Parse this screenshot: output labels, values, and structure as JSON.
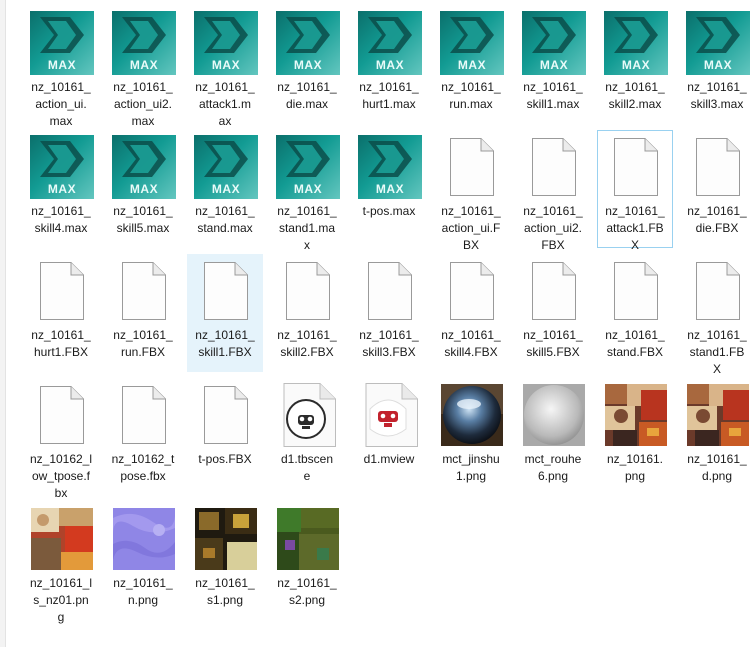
{
  "icon_text": "MAX",
  "files": [
    {
      "name": "nz_10161_action_ui.max",
      "type": "max",
      "label": "nz_10161_\naction_ui.\nmax"
    },
    {
      "name": "nz_10161_action_ui2.max",
      "type": "max",
      "label": "nz_10161_\naction_ui2.\nmax"
    },
    {
      "name": "nz_10161_attack1.max",
      "type": "max",
      "label": "nz_10161_\nattack1.m\nax"
    },
    {
      "name": "nz_10161_die.max",
      "type": "max",
      "label": "nz_10161_\ndie.max"
    },
    {
      "name": "nz_10161_hurt1.max",
      "type": "max",
      "label": "nz_10161_\nhurt1.max"
    },
    {
      "name": "nz_10161_run.max",
      "type": "max",
      "label": "nz_10161_\nrun.max"
    },
    {
      "name": "nz_10161_skill1.max",
      "type": "max",
      "label": "nz_10161_\nskill1.max"
    },
    {
      "name": "nz_10161_skill2.max",
      "type": "max",
      "label": "nz_10161_\nskill2.max"
    },
    {
      "name": "nz_10161_skill3.max",
      "type": "max",
      "label": "nz_10161_\nskill3.max"
    },
    {
      "name": "nz_10161_skill4.max",
      "type": "max",
      "label": "nz_10161_\nskill4.max"
    },
    {
      "name": "nz_10161_skill5.max",
      "type": "max",
      "label": "nz_10161_\nskill5.max"
    },
    {
      "name": "nz_10161_stand.max",
      "type": "max",
      "label": "nz_10161_\nstand.max"
    },
    {
      "name": "nz_10161_stand1.max",
      "type": "max",
      "label": "nz_10161_\nstand1.ma\nx"
    },
    {
      "name": "t-pos.max",
      "type": "max",
      "label": "t-pos.max"
    },
    {
      "name": "nz_10161_action_ui.FBX",
      "type": "doc",
      "label": "nz_10161_\naction_ui.F\nBX"
    },
    {
      "name": "nz_10161_action_ui2.FBX",
      "type": "doc",
      "label": "nz_10161_\naction_ui2.\nFBX"
    },
    {
      "name": "nz_10161_attack1.FBX",
      "type": "doc",
      "label": "nz_10161_\nattack1.FB\nX",
      "state": "focused"
    },
    {
      "name": "nz_10161_die.FBX",
      "type": "doc",
      "label": "nz_10161_\ndie.FBX"
    },
    {
      "name": "nz_10161_hurt1.FBX",
      "type": "doc",
      "label": "nz_10161_\nhurt1.FBX"
    },
    {
      "name": "nz_10161_run.FBX",
      "type": "doc",
      "label": "nz_10161_\nrun.FBX"
    },
    {
      "name": "nz_10161_skill1.FBX",
      "type": "doc",
      "label": "nz_10161_\nskill1.FBX",
      "state": "selected"
    },
    {
      "name": "nz_10161_skill2.FBX",
      "type": "doc",
      "label": "nz_10161_\nskill2.FBX"
    },
    {
      "name": "nz_10161_skill3.FBX",
      "type": "doc",
      "label": "nz_10161_\nskill3.FBX"
    },
    {
      "name": "nz_10161_skill4.FBX",
      "type": "doc",
      "label": "nz_10161_\nskill4.FBX"
    },
    {
      "name": "nz_10161_skill5.FBX",
      "type": "doc",
      "label": "nz_10161_\nskill5.FBX"
    },
    {
      "name": "nz_10161_stand.FBX",
      "type": "doc",
      "label": "nz_10161_\nstand.FBX"
    },
    {
      "name": "nz_10161_stand1.FBX",
      "type": "doc",
      "label": "nz_10161_\nstand1.FB\nX"
    },
    {
      "name": "nz_10162_low_tpose.fbx",
      "type": "doc",
      "label": "nz_10162_l\now_tpose.f\nbx"
    },
    {
      "name": "nz_10162_tpose.fbx",
      "type": "doc",
      "label": "nz_10162_t\npose.fbx"
    },
    {
      "name": "t-pos.FBX",
      "type": "doc",
      "label": "t-pos.FBX"
    },
    {
      "name": "d1.tbscene",
      "type": "tbscene",
      "label": "d1.tbscen\ne"
    },
    {
      "name": "d1.mview",
      "type": "mview",
      "label": "d1.mview"
    },
    {
      "name": "mct_jinshu1.png",
      "type": "png-sphere",
      "label": "mct_jinshu\n1.png"
    },
    {
      "name": "mct_rouhe6.png",
      "type": "png-grey",
      "label": "mct_rouhe\n6.png"
    },
    {
      "name": "nz_10161.png",
      "type": "png-tex",
      "label": "nz_10161.\npng"
    },
    {
      "name": "nz_10161_d.png",
      "type": "png-tex",
      "label": "nz_10161_\nd.png"
    },
    {
      "name": "nz_10161_ls_nz01.png",
      "type": "png-tex2",
      "label": "nz_10161_l\ns_nz01.pn\ng"
    },
    {
      "name": "nz_10161_n.png",
      "type": "png-normal",
      "label": "nz_10161_\nn.png"
    },
    {
      "name": "nz_10161_s1.png",
      "type": "png-dark",
      "label": "nz_10161_\ns1.png"
    },
    {
      "name": "nz_10161_s2.png",
      "type": "png-green",
      "label": "nz_10161_\ns2.png"
    }
  ]
}
